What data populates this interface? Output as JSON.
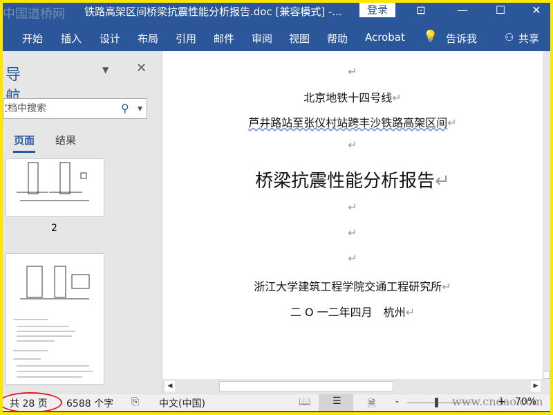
{
  "window": {
    "watermark_logo": "中国道桥网",
    "title": "铁路高架区间桥梁抗震性能分析报告.doc [兼容模式]  -...",
    "login": "登录",
    "controls": [
      "ribbon-display",
      "minimize",
      "maximize",
      "close"
    ]
  },
  "ribbon": {
    "tabs": [
      "开始",
      "插入",
      "设计",
      "布局",
      "引用",
      "邮件",
      "审阅",
      "视图",
      "帮助",
      "Acrobat"
    ],
    "tell_me": "告诉我",
    "share": "共享"
  },
  "nav": {
    "title": "导航",
    "search_placeholder": "在文档中搜索",
    "tabs": [
      "页面",
      "结果"
    ],
    "active_tab": "页面",
    "thumb_label": "2"
  },
  "document": {
    "lines": [
      "",
      "北京地铁十四号线",
      "芦井路站至张仪村站跨丰沙铁路高架区间",
      "",
      "桥梁抗震性能分析报告",
      "",
      "",
      "",
      "浙江大学建筑工程学院交通工程研究所",
      "二 O 一二年四月　杭州"
    ],
    "para_mark": "↵"
  },
  "status": {
    "pages": "共 28 页",
    "words": "6588 个字",
    "language": "中文(中国)",
    "zoom_minus": "-",
    "zoom_plus": "+",
    "zoom": "70%",
    "zoom_percent": 70,
    "watermark": "www.cndao.com"
  },
  "colors": {
    "accent": "#2b579a",
    "frame": "#ffe600",
    "annotation": "#e02020"
  }
}
